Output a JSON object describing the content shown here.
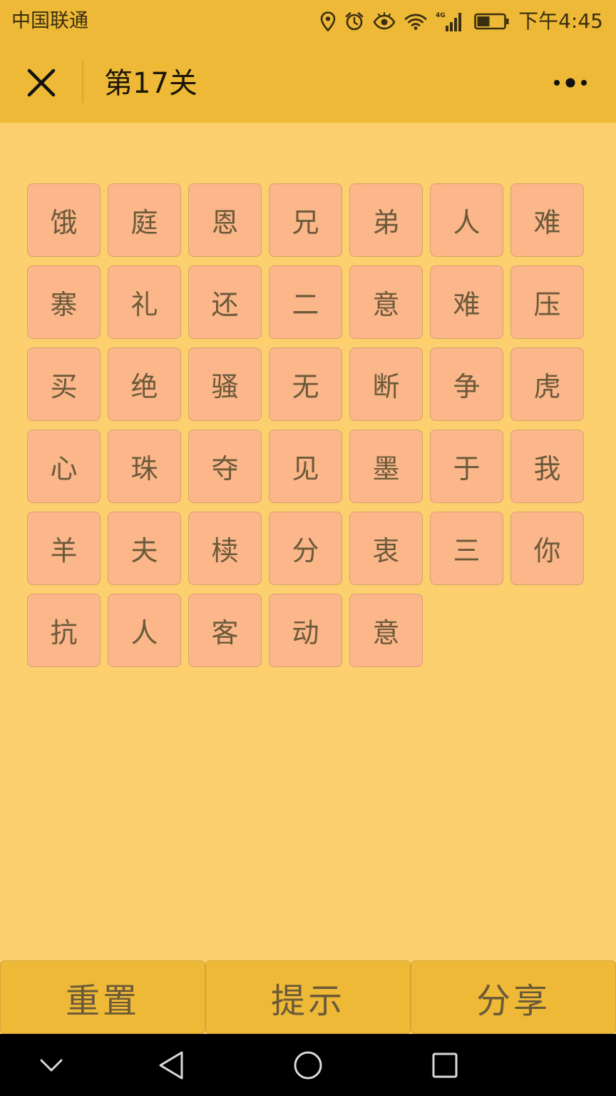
{
  "status_bar": {
    "carrier": "中国联通",
    "network_label": "4G",
    "time": "下午4:45",
    "battery_level": 0.45
  },
  "nav": {
    "title": "第17关",
    "close_icon": "close-icon",
    "more_icon": "more-dots-icon"
  },
  "grid": {
    "rows": [
      [
        "饿",
        "庭",
        "恩",
        "兄",
        "弟",
        "人",
        "难"
      ],
      [
        "寨",
        "礼",
        "还",
        "二",
        "意",
        "难",
        "压"
      ],
      [
        "买",
        "绝",
        "骚",
        "无",
        "断",
        "争",
        "虎"
      ],
      [
        "心",
        "珠",
        "夺",
        "见",
        "墨",
        "于",
        "我"
      ],
      [
        "羊",
        "夫",
        "椟",
        "分",
        "衷",
        "三",
        "你"
      ],
      [
        "抗",
        "人",
        "客",
        "动",
        "意"
      ]
    ]
  },
  "buttons": {
    "reset": "重置",
    "hint": "提示",
    "share": "分享"
  },
  "colors": {
    "header": "#EEB936",
    "background": "#FCD06E",
    "tile": "#FBB68A",
    "tile_text": "#6B5A3A"
  }
}
